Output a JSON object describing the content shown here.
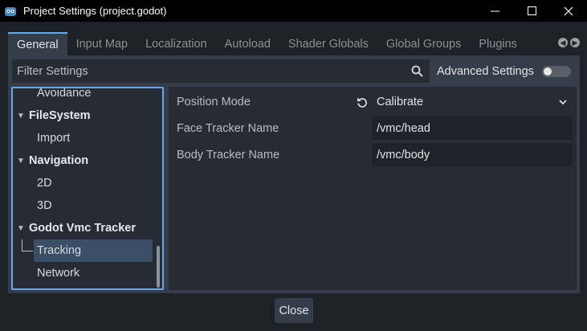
{
  "window": {
    "title": "Project Settings (project.godot)"
  },
  "tabs": [
    {
      "label": "General",
      "active": true
    },
    {
      "label": "Input Map"
    },
    {
      "label": "Localization"
    },
    {
      "label": "Autoload"
    },
    {
      "label": "Shader Globals"
    },
    {
      "label": "Global Groups"
    },
    {
      "label": "Plugins"
    }
  ],
  "filter": {
    "placeholder": "Filter Settings"
  },
  "advanced": {
    "label": "Advanced Settings",
    "enabled": false
  },
  "tree": {
    "items": [
      {
        "label": "Avoidance",
        "type": "child"
      },
      {
        "label": "FileSystem",
        "type": "section"
      },
      {
        "label": "Import",
        "type": "child"
      },
      {
        "label": "Navigation",
        "type": "section"
      },
      {
        "label": "2D",
        "type": "child"
      },
      {
        "label": "3D",
        "type": "child"
      },
      {
        "label": "Godot Vmc Tracker",
        "type": "section"
      },
      {
        "label": "Tracking",
        "type": "child",
        "selected": true
      },
      {
        "label": "Network",
        "type": "child"
      }
    ]
  },
  "properties": [
    {
      "label": "Position Mode",
      "value": "Calibrate",
      "kind": "dropdown"
    },
    {
      "label": "Face Tracker Name",
      "value": "/vmc/head",
      "kind": "text"
    },
    {
      "label": "Body Tracker Name",
      "value": "/vmc/body",
      "kind": "text"
    }
  ],
  "footer": {
    "close_label": "Close"
  },
  "colors": {
    "accent": "#6aa7e6",
    "selection": "#3b4e66",
    "panel": "#363d4a",
    "background": "#1d2229"
  }
}
